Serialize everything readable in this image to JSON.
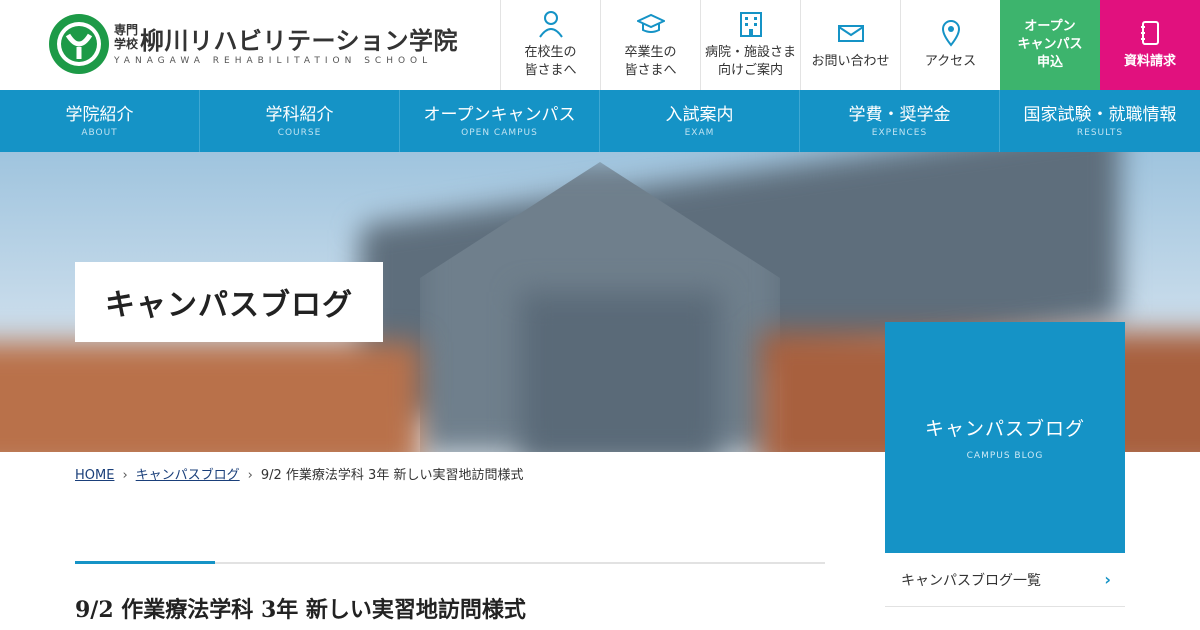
{
  "header": {
    "logo_prefix_line1": "専門",
    "logo_prefix_line2": "学校",
    "logo_name": "柳川リハビリテーション学院",
    "logo_en": "YANAGAWA REHABILITATION SCHOOL",
    "utility": [
      {
        "label": "在校生の\n皆さまへ",
        "icon": "person-icon"
      },
      {
        "label": "卒業生の\n皆さまへ",
        "icon": "graduation-cap-icon"
      },
      {
        "label": "病院・施設さま\n向けご案内",
        "icon": "building-icon"
      },
      {
        "label": "お問い合わせ",
        "icon": "mail-icon"
      },
      {
        "label": "アクセス",
        "icon": "map-pin-icon"
      }
    ],
    "cta_open": "オープン\nキャンパス\n申込",
    "cta_docs": "資料請求",
    "colors": {
      "cta_open": "#3db46d",
      "cta_docs": "#e1117e",
      "brand": "#1593c6"
    }
  },
  "nav": [
    {
      "jp": "学院紹介",
      "en": "ABOUT"
    },
    {
      "jp": "学科紹介",
      "en": "COURSE"
    },
    {
      "jp": "オープンキャンパス",
      "en": "OPEN CAMPUS"
    },
    {
      "jp": "入試案内",
      "en": "EXAM"
    },
    {
      "jp": "学費・奨学金",
      "en": "EXPENCES"
    },
    {
      "jp": "国家試験・就職情報",
      "en": "RESULTS"
    }
  ],
  "hero": {
    "title": "キャンパスブログ"
  },
  "breadcrumb": {
    "home": "HOME",
    "section": "キャンパスブログ",
    "current": "9/2 作業療法学科 3年 新しい実習地訪問様式"
  },
  "article": {
    "title": "9/2 作業療法学科 3年 新しい実習地訪問様式"
  },
  "sidebar": {
    "title": "キャンパスブログ",
    "subtitle": "CAMPUS BLOG",
    "link": "キャンパスブログ一覧"
  }
}
